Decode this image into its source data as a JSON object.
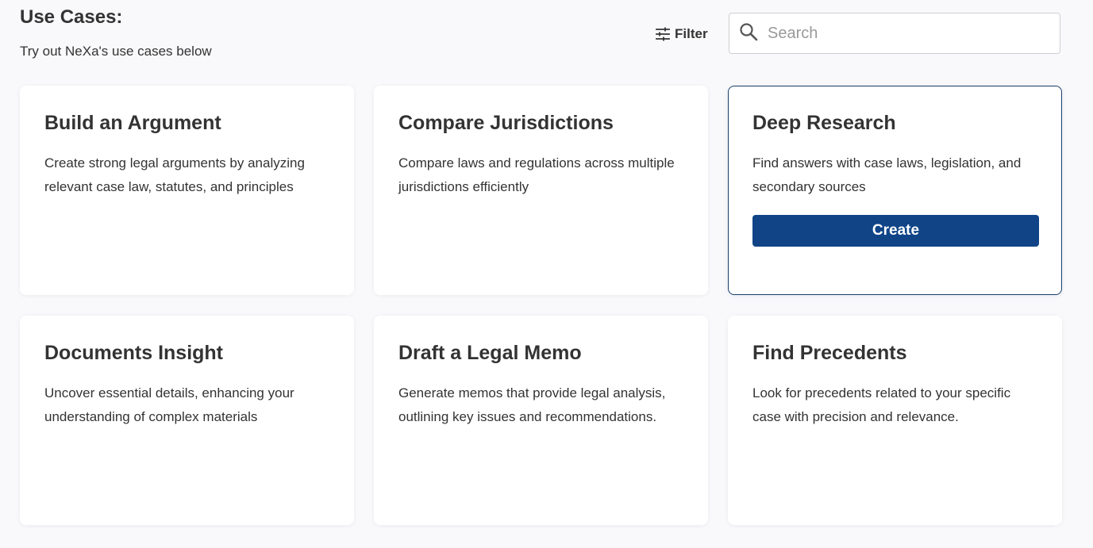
{
  "header": {
    "title": "Use Cases:",
    "subtitle": "Try out NeXa's use cases below",
    "filter_label": "Filter",
    "filter_icon": "sliders-icon",
    "search_placeholder": "Search",
    "search_value": "",
    "search_icon": "search-icon"
  },
  "colors": {
    "accent": "#104487",
    "selected_border": "#1a3f6b",
    "text": "#333333",
    "background": "#f9f9fb"
  },
  "cards": [
    {
      "title": "Build an Argument",
      "description": "Create strong legal arguments by analyzing relevant case law, statutes, and principles"
    },
    {
      "title": "Compare Jurisdictions",
      "description": "Compare laws and regulations across multiple jurisdictions efficiently"
    },
    {
      "title": "Deep Research",
      "description": "Find answers with case laws, legislation, and secondary sources",
      "selected": true,
      "button_label": "Create"
    },
    {
      "title": "Documents Insight",
      "description": "Uncover essential details, enhancing your understanding of complex materials"
    },
    {
      "title": "Draft a Legal Memo",
      "description": "Generate memos that provide legal analysis, outlining key issues and recommendations."
    },
    {
      "title": "Find Precedents",
      "description": "Look for precedents related to your specific case with precision and relevance."
    }
  ]
}
